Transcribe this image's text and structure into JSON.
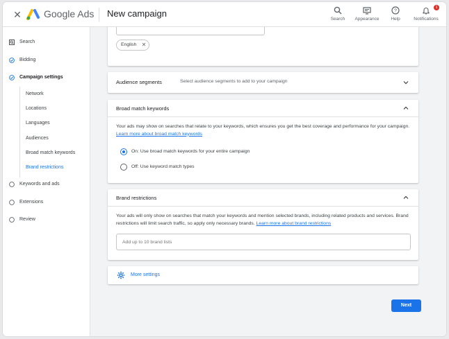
{
  "header": {
    "close_icon": "close-icon",
    "brand": "Google Ads",
    "page_title": "New campaign",
    "actions": [
      {
        "label": "Search",
        "icon": "search-icon"
      },
      {
        "label": "Appearance",
        "icon": "appearance-icon"
      },
      {
        "label": "Help",
        "icon": "help-icon"
      },
      {
        "label": "Notifications",
        "icon": "bell-icon",
        "badge": "1"
      }
    ]
  },
  "sidebar": {
    "items": [
      {
        "label": "Search",
        "icon": "search-campaign-icon"
      },
      {
        "label": "Bidding",
        "icon": "check-circle-icon"
      },
      {
        "label": "Campaign settings",
        "icon": "check-circle-icon"
      },
      {
        "label": "Keywords and ads",
        "icon": "empty-circle-icon"
      },
      {
        "label": "Extensions",
        "icon": "empty-circle-icon"
      },
      {
        "label": "Review",
        "icon": "empty-circle-icon"
      }
    ],
    "sub_items": [
      "Network",
      "Locations",
      "Languages",
      "Audiences",
      "Broad match keywords",
      "Brand restrictions"
    ],
    "active_sub_item": "Brand restrictions"
  },
  "languages_card": {
    "chip": "English"
  },
  "audience_card": {
    "title": "Audience segments",
    "summary": "Select audience segments to add to your campaign"
  },
  "broad_match_card": {
    "title": "Broad match keywords",
    "description": "Your ads may show on searches that relate to your keywords, which ensures you get the best coverage and performance for your campaign.",
    "link": "Learn more about broad match keywords",
    "options": [
      {
        "label": "On: Use broad match keywords for your entire campaign",
        "selected": true
      },
      {
        "label": "Off: Use keyword match types",
        "selected": false
      }
    ]
  },
  "brand_card": {
    "title": "Brand restrictions",
    "description": "Your ads will only show on searches that match your keywords and mention selected brands, including related products and services. Brand restrictions will limit search traffic, so apply only necessary brands.",
    "link": "Learn more about brand restrictions",
    "placeholder": "Add up to 10 brand lists"
  },
  "more_settings": {
    "label": "More settings",
    "icon": "gear-icon"
  },
  "footer": {
    "next_label": "Next"
  },
  "colors": {
    "accent": "#1a73e8",
    "badge": "#d93025",
    "background": "#f1f3f4"
  }
}
